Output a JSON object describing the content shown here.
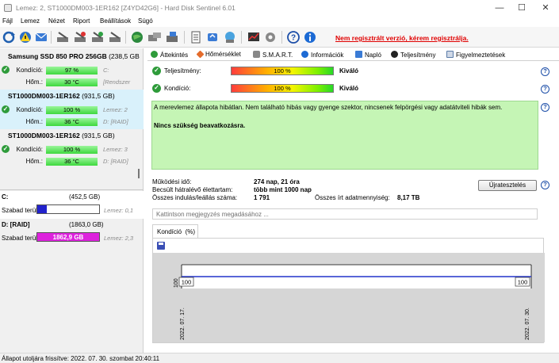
{
  "window": {
    "title": "Lemez: 2, ST1000DM003-1ER162 [Z4YD42G6]  -  Hard Disk Sentinel 6.01",
    "minimize": "—",
    "maximize": "☐",
    "close": "✕"
  },
  "menu": [
    "Fájl",
    "Lemez",
    "Nézet",
    "Riport",
    "Beállítások",
    "Súgó"
  ],
  "toolbar": {
    "unregistered": "Nem regisztrált verzió, kérem regisztrálja."
  },
  "disks": [
    {
      "name": "Samsung SSD 850 PRO 256GB",
      "size": "(238,5 GB",
      "condition_label": "Kondíció:",
      "condition": "97 %",
      "condition_pct": 97,
      "condition_side": "C:",
      "temp_label": "Hőm.:",
      "temp": "30 °C",
      "temp_side": "[Rendszer",
      "selected": false
    },
    {
      "name": "ST1000DM003-1ER162",
      "size": "(931,5 GB)",
      "condition_label": "Kondíció:",
      "condition": "100 %",
      "condition_pct": 100,
      "condition_side": "Lemez: 2",
      "temp_label": "Hőm.:",
      "temp": "36 °C",
      "temp_side": "D: [RAID]",
      "selected": true
    },
    {
      "name": "ST1000DM003-1ER162",
      "size": "(931,5 GB)",
      "condition_label": "Kondíció:",
      "condition": "100 %",
      "condition_pct": 100,
      "condition_side": "Lemez: 3",
      "temp_label": "Hőm.:",
      "temp": "36 °C",
      "temp_side": "D: [RAID]",
      "selected": false
    }
  ],
  "volumes": [
    {
      "name": "C:",
      "size": "(452,5 GB)",
      "free_label": "Szabad terület",
      "free": "72,1 GB",
      "free_pct": 16,
      "disk": "Lemez: 0,1",
      "color": "#2222cc"
    },
    {
      "name": "D: [RAID]",
      "size": "(1863,0 GB)",
      "free_label": "Szabad terület",
      "free": "1862,9 GB",
      "free_pct": 100,
      "disk": "Lemez: 2,3",
      "color": "#dd22dd"
    }
  ],
  "tabs": [
    "Áttekintés",
    "Hőmérséklet",
    "S.M.A.R.T.",
    "Információk",
    "Napló",
    "Teljesítmény",
    "Figyelmeztetések"
  ],
  "overview": {
    "performance_label": "Teljesítmény:",
    "performance": "100 %",
    "performance_rating": "Kiváló",
    "health_label": "Kondíció:",
    "health": "100 %",
    "health_rating": "Kiváló",
    "summary": "A merevlemez állapota hibátlan. Nem található hibás vagy gyenge szektor, nincsenek felpörgési vagy adatátviteli hibák sem.",
    "action": "Nincs szükség beavatkozásra.",
    "power_on_label": "Működési idő:",
    "power_on": "274 nap, 21 óra",
    "remaining_label": "Becsült hátralévő élettartam:",
    "remaining": "több mint 1000 nap",
    "starts_label": "Összes indulás/leállás száma:",
    "starts": "1 791",
    "written_label": "Összes írt adatmennyiség:",
    "written": "8,17 TB",
    "retest": "Újratesztelés",
    "note_placeholder": "Kattintson megjegyzés megadásához ..."
  },
  "chart_tab": "Kondíció  (%)",
  "help": "?",
  "chart_data": {
    "type": "line",
    "x": [
      "2022. 07. 17.",
      "2022. 07. 30."
    ],
    "series": [
      {
        "values": [
          100,
          100
        ]
      }
    ],
    "point_labels": [
      "100",
      "100"
    ],
    "ytick": "100",
    "color": "#2233cc"
  },
  "status": "Állapot utoljára frissítve: 2022. 07. 30. szombat 20:40:11"
}
